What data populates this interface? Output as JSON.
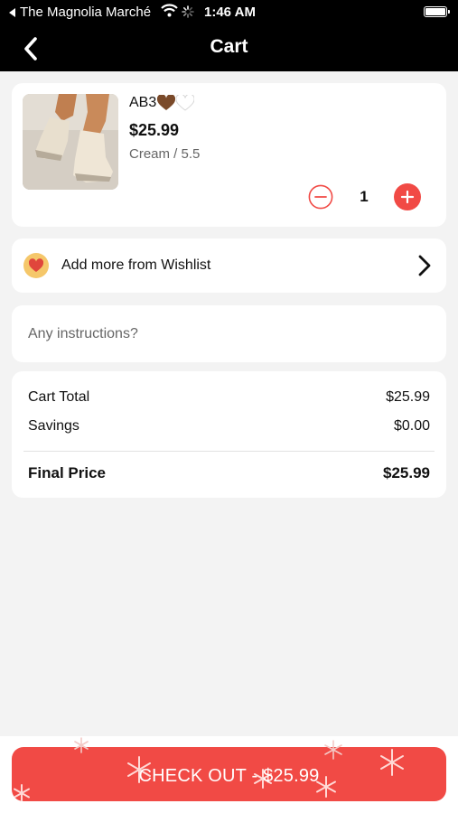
{
  "status_bar": {
    "back_app": "The Magnolia Marché",
    "time": "1:46 AM"
  },
  "nav": {
    "title": "Cart"
  },
  "cart_item": {
    "name": "AB3",
    "price": "$25.99",
    "variant": "Cream / 5.5",
    "quantity": "1",
    "heart_colors": [
      "#7a4a2a",
      "#ffffff"
    ]
  },
  "wishlist": {
    "label": "Add more from Wishlist"
  },
  "instructions": {
    "placeholder": "Any instructions?"
  },
  "summary": {
    "cart_total_label": "Cart Total",
    "cart_total_value": "$25.99",
    "savings_label": "Savings",
    "savings_value": "$0.00",
    "final_label": "Final Price",
    "final_value": "$25.99"
  },
  "checkout": {
    "label": "CHECK OUT - $25.99"
  },
  "colors": {
    "accent": "#f14a45",
    "header": "#000000",
    "background": "#f3f3f3"
  }
}
